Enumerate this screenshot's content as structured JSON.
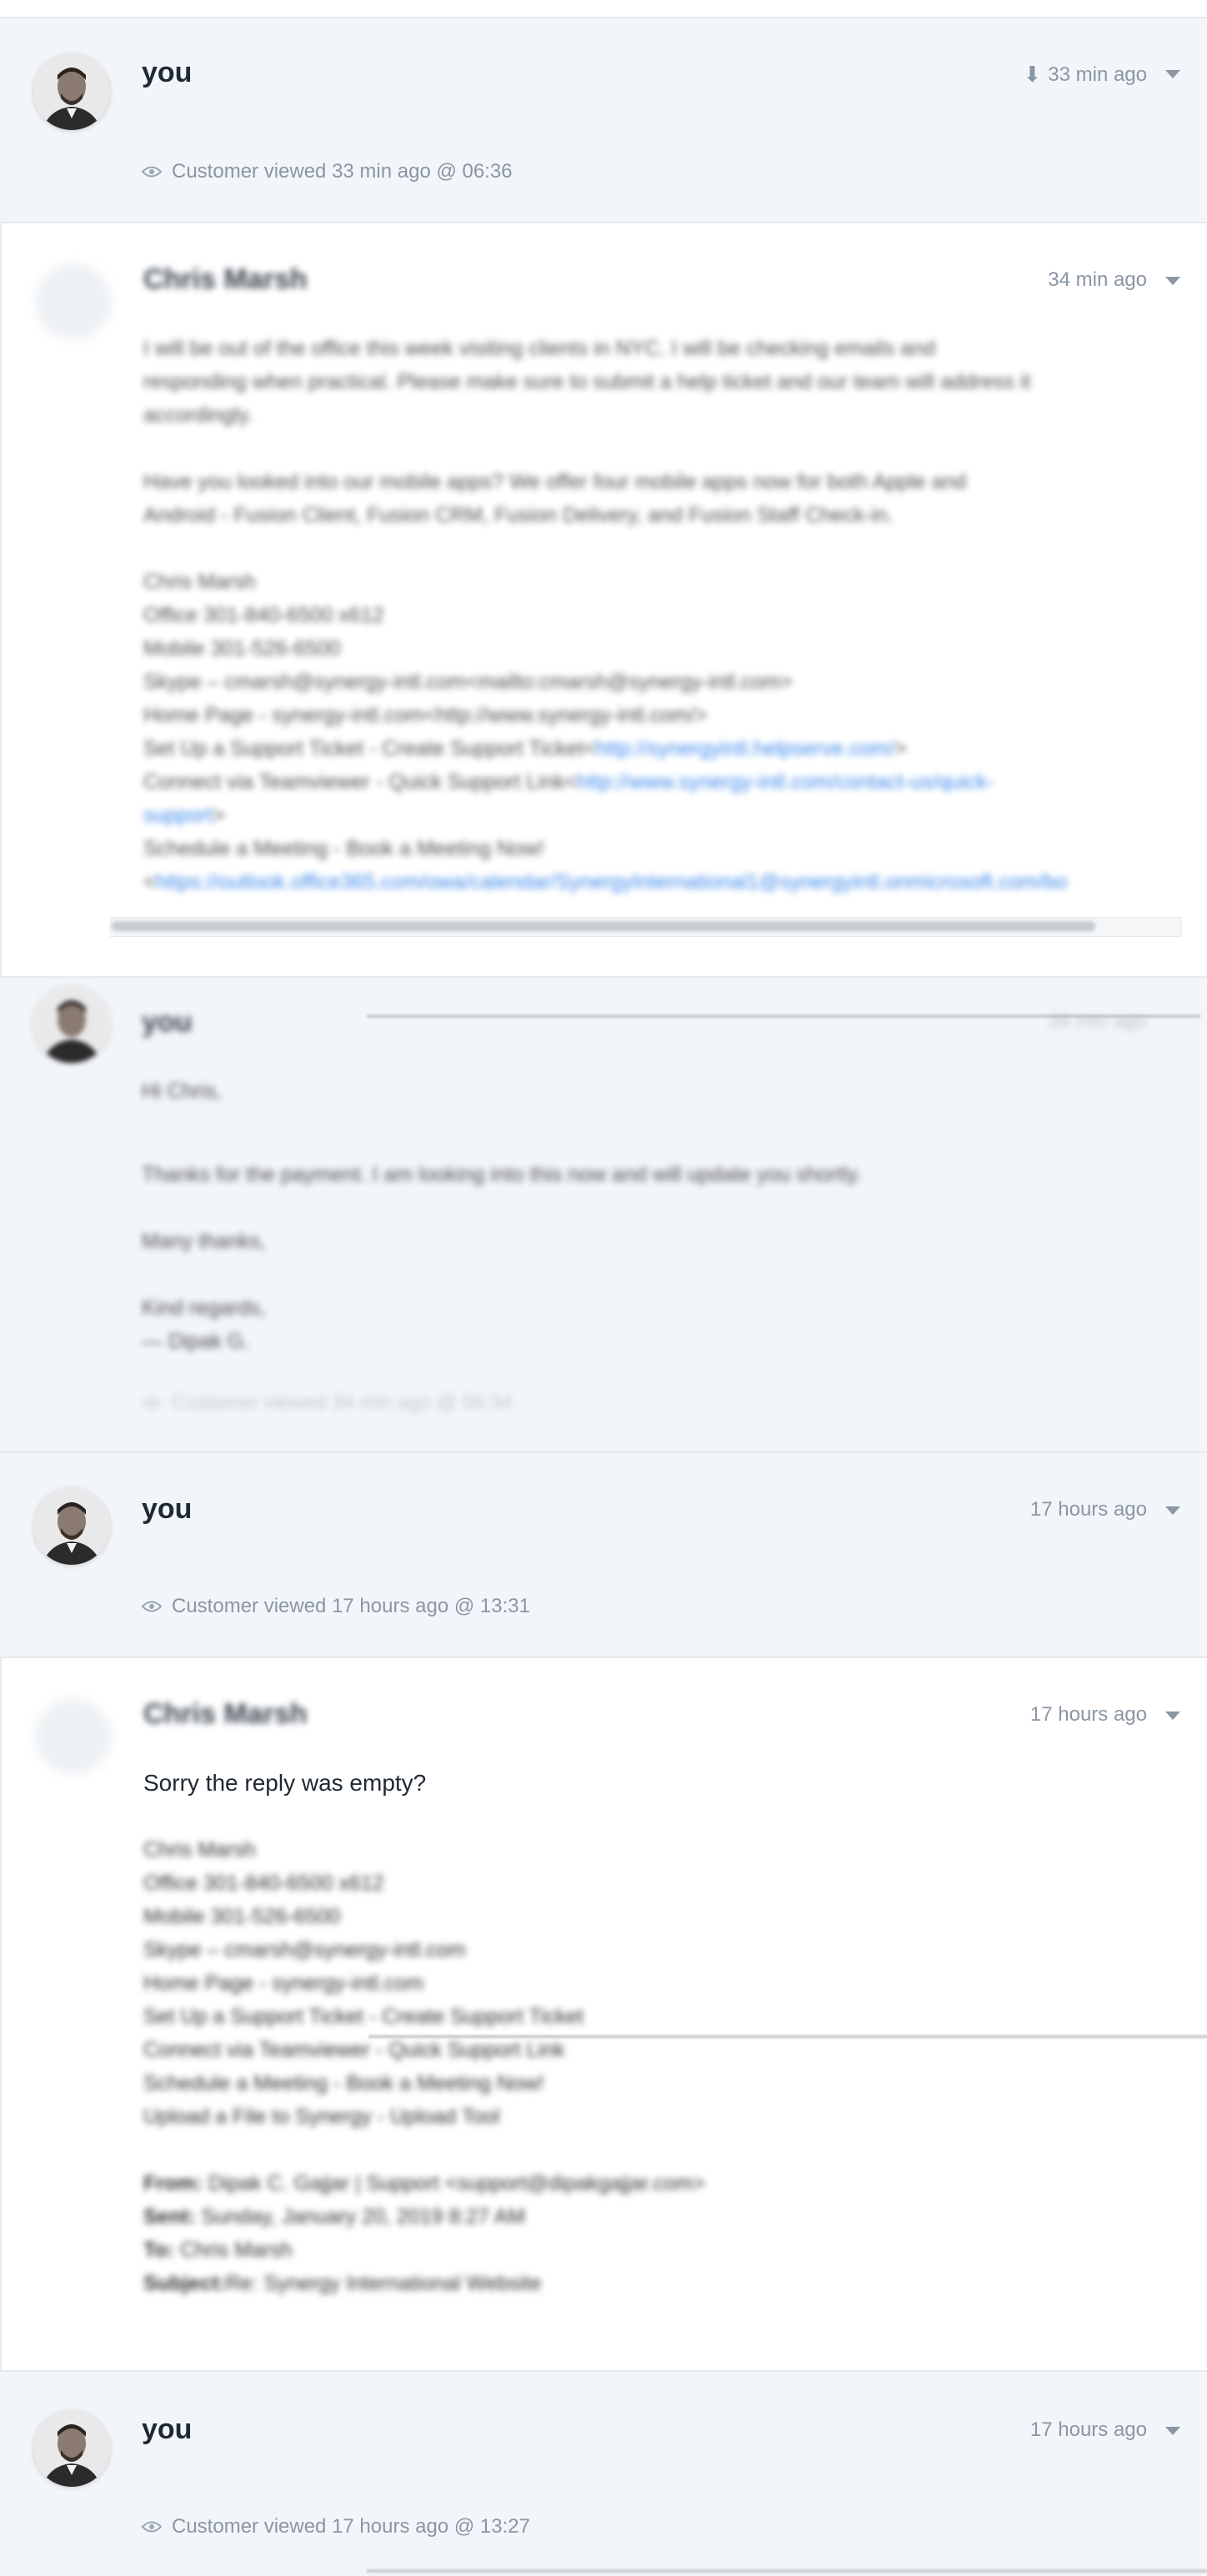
{
  "messages": [
    {
      "author": "you",
      "time": "33 min ago",
      "viewed": "Customer viewed 33 min ago @ 06:36"
    },
    {
      "author": "Chris Marsh",
      "time": "34 min ago",
      "paragraphs": [
        "I will be out of the office this week visiting clients in NYC. I will be checking emails and",
        "responding when practical. Please make sure to submit a help ticket and our team will address it",
        "accordingly."
      ],
      "paragraph2": [
        "Have you looked into our mobile apps? We offer four mobile apps now for both Apple and",
        "Android -  Fusion Client, Fusion CRM, Fusion Delivery, and Fusion Staff Check-in."
      ],
      "signature": [
        "Chris Marsh",
        "Office 301-840-6500 x612",
        "Mobile 301-526-6500",
        "Skype – cmarsh@synergy-intl.com<mailto:cmarsh@synergy-intl.com>",
        "Home Page - synergy-intl.com<http://www.synergy-intl.com/>"
      ],
      "ticket_prefix": "Set Up a Support Ticket - Create Support Ticket<",
      "ticket_link": "http://synergyintl.helpserve.com/",
      "ticket_suffix": ">",
      "teamviewer_prefix": "Connect via Teamviewer - Quick Support Link<",
      "teamviewer_link": "http://www.synergy-intl.com/contact-us/quick-",
      "teamviewer_link2": "support",
      "teamviewer_suffix": ">",
      "meeting_line": "Schedule a Meeting - Book a Meeting Now!",
      "meeting_prefix": "<",
      "meeting_link": "https://outlook.office365.com/owa/calendar/SynergyInternational1@synergyintl.onmicrosoft.com/bo"
    },
    {
      "author": "you",
      "time": "34 min ago",
      "lines": [
        "Hi Chris,",
        "Thanks for the payment. I am looking into this now and will update you shortly.",
        "Many thanks,",
        "Kind regards,",
        "— Dipak G."
      ],
      "viewed": "Customer viewed 34 min ago @ 06:34"
    },
    {
      "author": "you",
      "time": "17 hours ago",
      "viewed": "Customer viewed 17 hours ago @ 13:31"
    },
    {
      "author": "Chris Marsh",
      "time": "17 hours ago",
      "main": "Sorry the reply was empty?",
      "signature": [
        "Chris Marsh",
        "Office 301-840-6500 x612",
        "Mobile 301-526-6500",
        "Skype – cmarsh@synergy-intl.com",
        "Home Page - synergy-intl.com",
        "Set Up a Support Ticket - Create Support Ticket",
        "Connect via Teamviewer - Quick Support Link",
        "Schedule a Meeting - Book a Meeting Now!",
        "Upload a File to Synergy - Upload Tool"
      ],
      "from_label": "From:",
      "from_value": "Dipak C. Gajjar | Support <support@dipakgajjar.com>",
      "sent_label": "Sent:",
      "sent_value": "Sunday, January 20, 2019 8:27 AM",
      "to_label": "To:",
      "to_value": "Chris Marsh",
      "subject_label": "Subject:",
      "subject_value": "Re: Synergy International Website"
    },
    {
      "author": "you",
      "time": "17 hours ago",
      "viewed": "Customer viewed 17 hours ago @ 13:27"
    }
  ],
  "icons": {
    "download": "download-icon",
    "caret": "chevron-down-icon",
    "eye": "eye-icon",
    "avatar": "avatar"
  },
  "colors": {
    "note_bg": "#f2f5f9",
    "link": "#1a73e8",
    "muted": "#8a96a3"
  }
}
